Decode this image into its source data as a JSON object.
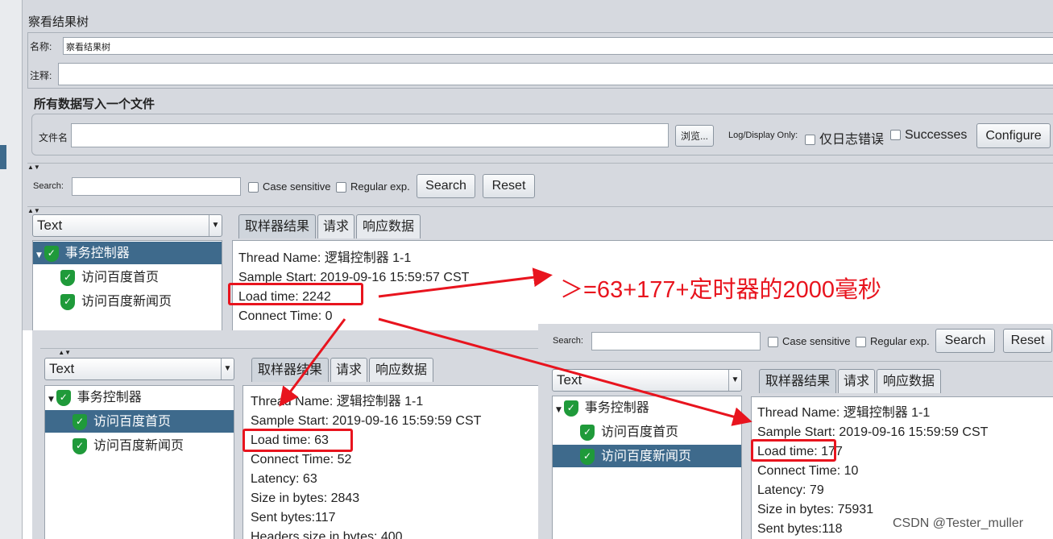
{
  "top": {
    "title": "察看结果树",
    "name_label": "名称:",
    "name_value": "察看结果树",
    "comment_label": "注释:",
    "section_title": "所有数据写入一个文件",
    "file_label": "文件名",
    "browse_label": "浏览...",
    "log_display_label": "Log/Display Only:",
    "errors_label": "仅日志错误",
    "successes_label": "Successes",
    "configure_label": "Configure",
    "search_label": "Search:",
    "case_label": "Case sensitive",
    "regex_label": "Regular exp.",
    "search_btn": "Search",
    "reset_btn": "Reset",
    "renderer": "Text",
    "tree": [
      "事务控制器",
      "访问百度首页",
      "访问百度新闻页"
    ],
    "selected": 0,
    "tabs": [
      "取样器结果",
      "请求",
      "响应数据"
    ],
    "details": [
      "Thread Name: 逻辑控制器 1-1",
      "Sample Start: 2019-09-16 15:59:57 CST",
      "Load time: 2242",
      "Connect Time: 0"
    ]
  },
  "left": {
    "search_label": "Search:",
    "case_label": "Case sensitive",
    "regex_label": "Regular exp.",
    "search_btn": "Search",
    "reset_btn": "Reset",
    "renderer": "Text",
    "tree": [
      "事务控制器",
      "访问百度首页",
      "访问百度新闻页"
    ],
    "tabs": [
      "取样器结果",
      "请求",
      "响应数据"
    ],
    "details": [
      "Thread Name: 逻辑控制器 1-1",
      "Sample Start: 2019-09-16 15:59:59 CST",
      "Load time: 63",
      "Connect Time: 52",
      "Latency: 63",
      "Size in bytes: 2843",
      "Sent bytes:117",
      "Headers size in bytes: 400"
    ]
  },
  "right": {
    "search_label": "Search:",
    "case_label": "Case sensitive",
    "regex_label": "Regular exp.",
    "search_btn": "Search",
    "reset_btn": "Reset",
    "renderer": "Text",
    "tree": [
      "事务控制器",
      "访问百度首页",
      "访问百度新闻页"
    ],
    "tabs": [
      "取样器结果",
      "请求",
      "响应数据"
    ],
    "details": [
      "Thread Name: 逻辑控制器 1-1",
      "Sample Start: 2019-09-16 15:59:59 CST",
      "Load time: 177",
      "Connect Time: 10",
      "Latency: 79",
      "Size in bytes: 75931",
      "Sent bytes:118"
    ]
  },
  "annotation": "＞=63+177+定时器的2000毫秒",
  "watermark": "CSDN @Tester_muller",
  "colors": {
    "annotation": "#e8141e",
    "selection": "#3e6a8c",
    "success": "#1f9a3a"
  },
  "icons": {
    "tree_status": "green-shield-check-icon"
  }
}
